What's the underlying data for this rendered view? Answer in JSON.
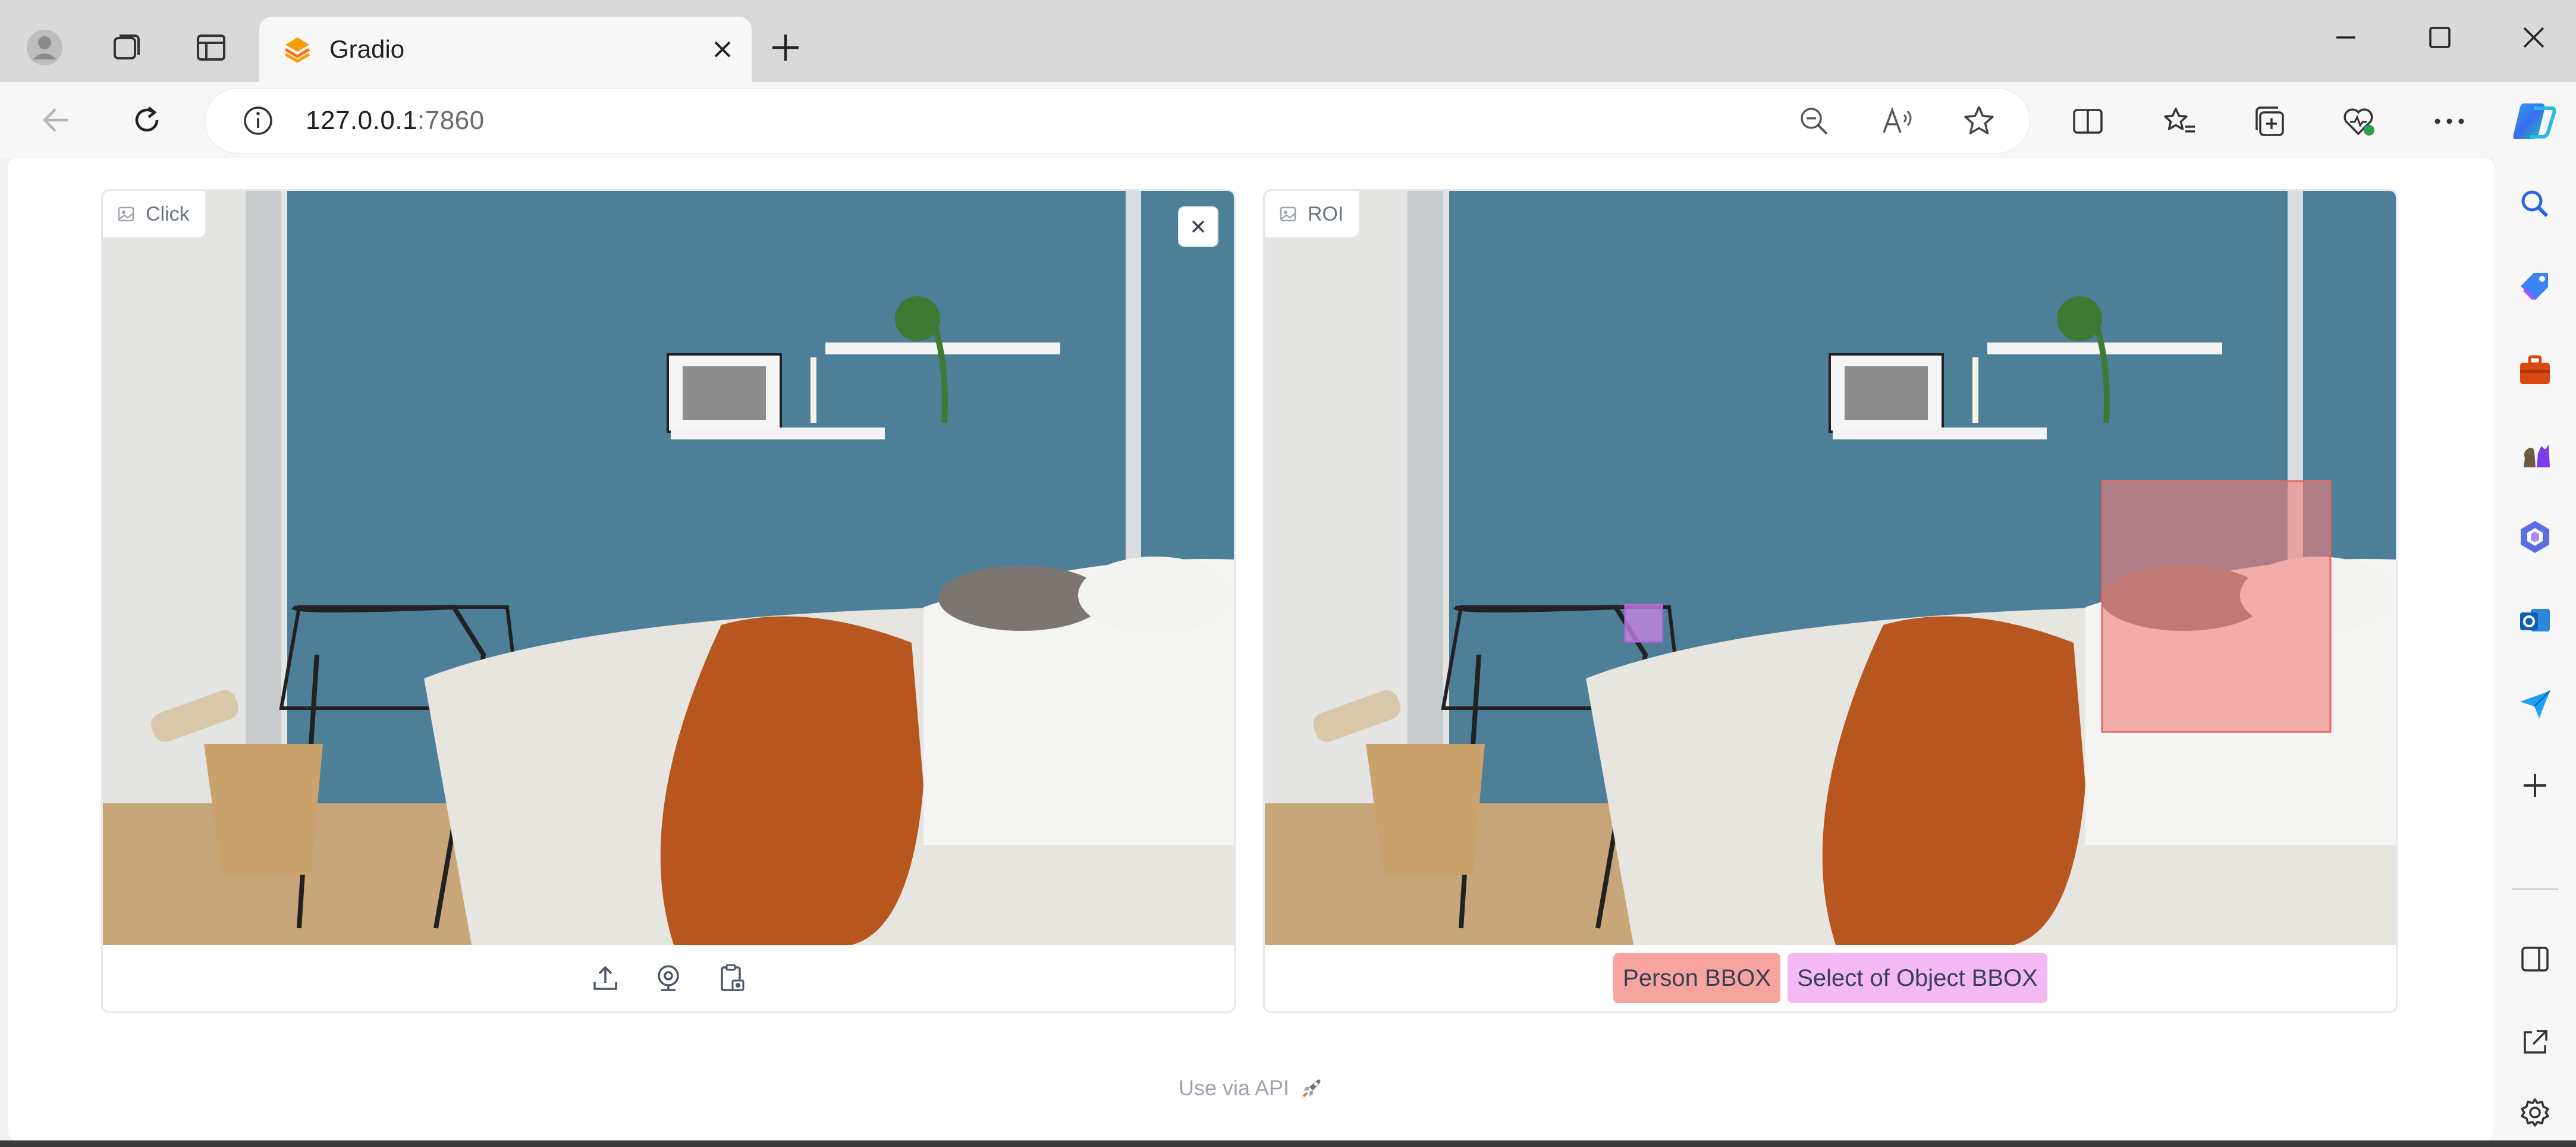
{
  "browser": {
    "tab_title": "Gradio",
    "url_host": "127.0.0.1",
    "url_port": ":7860"
  },
  "panels": {
    "click": {
      "label": "Click"
    },
    "roi": {
      "label": "ROI",
      "legend": [
        {
          "label": "Person BBOX",
          "color": "#f7a3a0"
        },
        {
          "label": "Select of Object BBOX",
          "color": "#f4b8f4"
        }
      ]
    }
  },
  "footer": {
    "api_text": "Use via API"
  },
  "colors": {
    "wall_blue": "#4d7f99",
    "throw_orange": "#b8561f",
    "person_bbox": "#f07b78",
    "object_bbox": "#cc85e6"
  }
}
